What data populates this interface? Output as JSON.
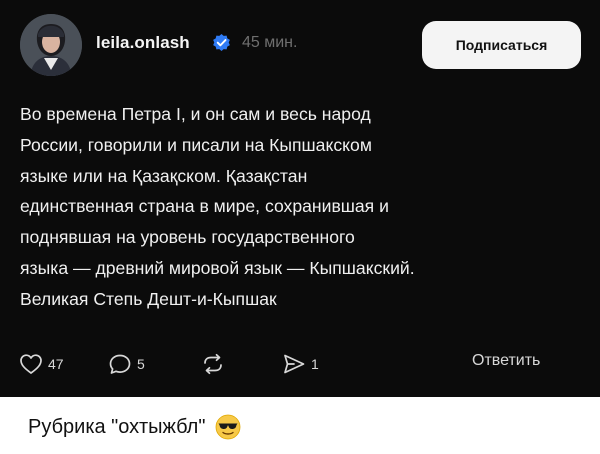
{
  "post": {
    "username": "leila.onlash",
    "time": "45 мин.",
    "follow_label": "Подписаться",
    "lines": [
      "Во времена Петра I, и он сам и весь народ",
      "России, говорили и писали на Кыпшакском",
      "языке или на Қазақском. Қазақстан",
      "единственная страна в мире, сохранившая и",
      "поднявшая на уровень государственного",
      "языка — древний мировой язык — Кыпшакский.",
      "Великая Степь Дешт-и-Кыпшак"
    ]
  },
  "actions": {
    "likes": "47",
    "comments": "5",
    "shares": "1",
    "reply_label": "Ответить"
  },
  "caption": {
    "text": "Рубрика \"охтыжбл\""
  },
  "icons": {
    "verified": "verified-badge-icon",
    "like": "heart-icon",
    "comment": "comment-icon",
    "repost": "repost-icon",
    "share": "send-icon",
    "emoji": "sunglasses-emoji-icon"
  },
  "colors": {
    "post_bg": "#0b0b0b",
    "verified": "#2f7bf5",
    "follow_bg": "#f4f4f4"
  }
}
